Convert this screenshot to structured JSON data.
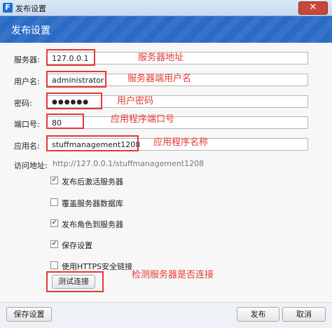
{
  "window": {
    "icon_letter": "F",
    "title": "发布设置",
    "close_glyph": "✕"
  },
  "header": {
    "title": "发布设置"
  },
  "form": {
    "server_label": "服务器:",
    "server_value": "127.0.0.1",
    "user_label": "用户名:",
    "user_value": "administrator",
    "password_label": "密码:",
    "password_value": "●●●●●●",
    "port_label": "端口号:",
    "port_value": "80",
    "app_label": "应用名:",
    "app_value": "stuffmanagement1208",
    "url_label": "访问地址:",
    "url_value": "http://127.0.0.1/stuffmanagement1208"
  },
  "options": [
    {
      "label": "发布后激活服务器",
      "checked": true
    },
    {
      "label": "覆盖服务器数据库",
      "checked": false
    },
    {
      "label": "发布角色到服务器",
      "checked": true
    },
    {
      "label": "保存设置",
      "checked": true
    },
    {
      "label": "使用HTTPS安全链接",
      "checked": false
    }
  ],
  "test_button": "测试连接",
  "annotations": {
    "server": "服务器地址",
    "user": "服务器端用户名",
    "password": "用户密码",
    "port": "应用程序端口号",
    "app": "应用程序名称",
    "test": "检测服务器是否连接",
    "color": "#e53935"
  },
  "footer": {
    "save_label": "保存设置",
    "publish_label": "发布",
    "cancel_label": "取消"
  },
  "colors": {
    "header_bg": "#2a6bc6",
    "annotation": "#e53935"
  }
}
